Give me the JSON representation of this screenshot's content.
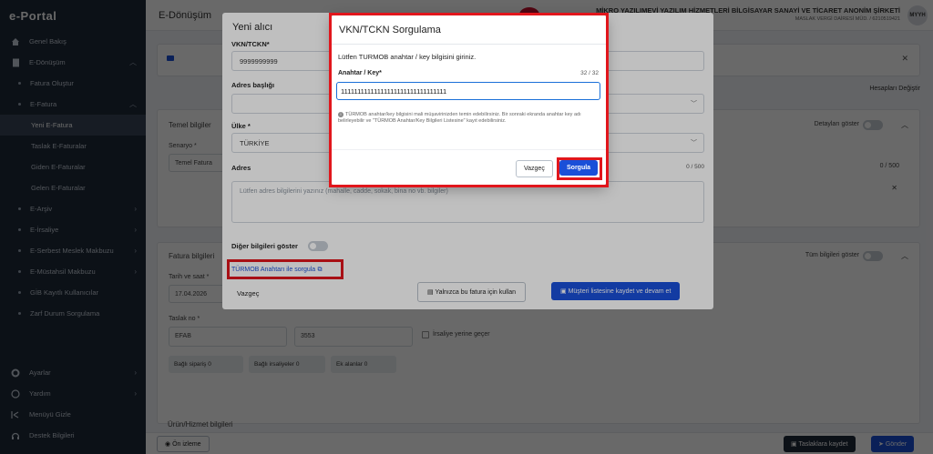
{
  "sidebar": {
    "logo": "e-Portal",
    "items": [
      {
        "label": "Genel Bakış"
      },
      {
        "label": "E-Dönüşüm"
      },
      {
        "label": "Fatura Oluştur"
      },
      {
        "label": "E-Fatura"
      },
      {
        "label": "Yeni E-Fatura"
      },
      {
        "label": "Taslak E-Faturalar"
      },
      {
        "label": "Giden E-Faturalar"
      },
      {
        "label": "Gelen E-Faturalar"
      },
      {
        "label": "E-Arşiv"
      },
      {
        "label": "E-İrsaliye"
      },
      {
        "label": "E-Serbest Meslek Makbuzu"
      },
      {
        "label": "E-Müstahsil Makbuzu"
      },
      {
        "label": "GİB Kayıtlı Kullanıcılar"
      },
      {
        "label": "Zarf Durum Sorgulama"
      }
    ],
    "bottom": [
      {
        "label": "Ayarlar"
      },
      {
        "label": "Yardım"
      },
      {
        "label": "Menüyü Gizle"
      },
      {
        "label": "Destek Bilgileri"
      }
    ]
  },
  "topbar": {
    "page_title": "E-Dönüşüm",
    "company_name": "MİKRO YAZILIMEVİ YAZILIM HİZMETLERİ BİLGİSAYAR SANAYİ VE TİCARET ANONİM ŞİRKETİ",
    "company_sub": "MASLAK VERGİ DAİRESİ MÜD. / 6210519421",
    "avatar": "MYYH"
  },
  "background": {
    "temel_bilgiler": "Temel bilgiler",
    "senaryo_label": "Senaryo *",
    "senaryo_value": "Temel Fatura",
    "detaylari_goster": "Detayları göster",
    "hesaplari_degistir": "Hesapları Değiştir",
    "counter": "0 / 500",
    "fatura_bilgileri": "Fatura bilgileri",
    "tum_bilgileri_goster": "Tüm bilgileri göster",
    "tarih_label": "Tarih ve saat *",
    "tarih_value": "17.04.2026",
    "taslak_no_label": "Taslak no *",
    "seri": "EFAB",
    "sira": "3553",
    "irsaliye_yerine_gecer": "İrsaliye yerine geçer",
    "bagli_siparis": "Bağlı sipariş",
    "bagli_irsaliyeler": "Bağlı irsaliyeler",
    "ek_alanlar": "Ek alanlar",
    "zero": "0",
    "urun_hizmet": "Ürün/Hizmet bilgileri",
    "on_izleme": "Ön izleme",
    "taslaklara_kaydet": "Taslaklara kaydet",
    "gonder": "Gönder"
  },
  "alici_modal": {
    "title": "Yeni alıcı",
    "vkn_label": "VKN/TCKN*",
    "vkn_value": "9999999999",
    "adres_basligi_label": "Adres başlığı",
    "ulke_label": "Ülke *",
    "ulke_value": "TÜRKİYE",
    "adres_label": "Adres",
    "adres_placeholder": "Lütfen adres bilgilerini yazınız (mahalle, cadde, sokak, bina no vb. bilgiler)",
    "adres_counter": "0 / 500",
    "diger_bilgileri_goster": "Diğer bilgileri göster",
    "turmob_link": "TÜRMOB Anahtarı ile sorgula",
    "vazgec": "Vazgeç",
    "yalnizca_bu_fatura": "Yalnızca bu fatura için kullan",
    "musteri_kaydet": "Müşteri listesine kaydet ve devam et"
  },
  "sorgulama_dialog": {
    "title": "VKN/TCKN Sorgulama",
    "description": "Lütfen TURMOB anahtar / key bilgisini giriniz.",
    "key_label": "Anahtar / Key*",
    "key_counter": "32 / 32",
    "key_value": "11111111111111111111111111111111",
    "hint": "TÜRMOB anahtar/key bilgisini mali müşavirinizden temin edebilirsiniz. Bir sonraki ekranda anahtar key adı belirleyebilir ve \"TÜRMOB Anahtar/Key Bilgileri Listesine\" kayıt edebilirsiniz.",
    "vazgec": "Vazgeç",
    "sorgula": "Sorgula"
  },
  "colors": {
    "highlight": "#e1161c",
    "primary": "#1a4fd8",
    "sidebar": "#1f2a3a"
  }
}
